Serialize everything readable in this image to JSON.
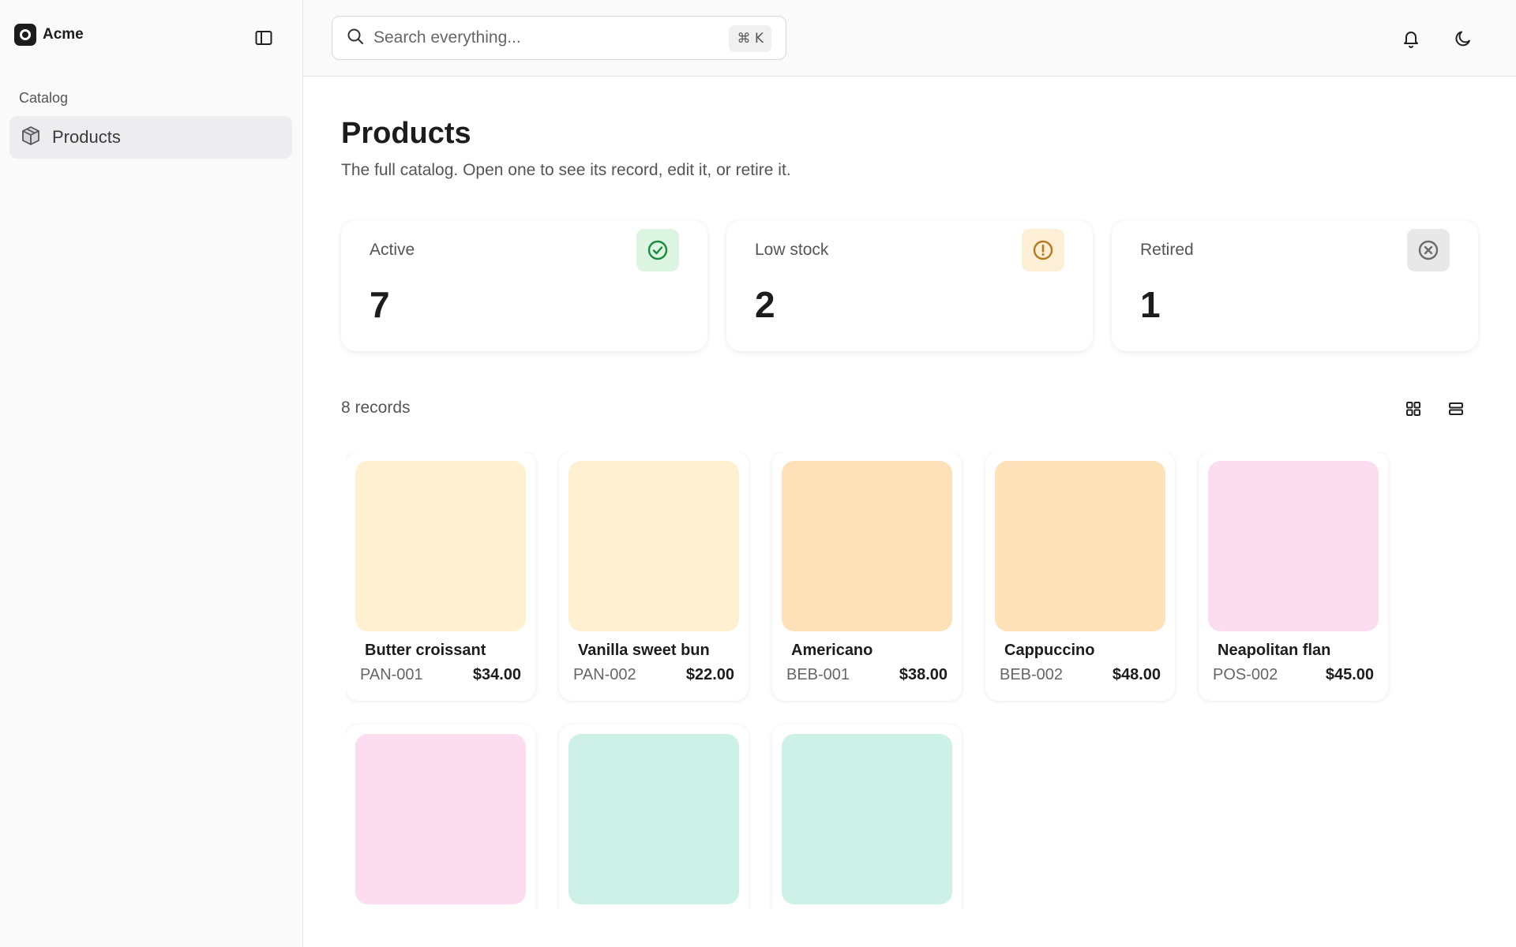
{
  "app": {
    "name": "Acme"
  },
  "sidebar": {
    "section_label": "Catalog",
    "items": [
      {
        "label": "Products",
        "icon": "package-icon",
        "active": true
      }
    ]
  },
  "topbar": {
    "search_placeholder": "Search everything...",
    "shortcut": "⌘ K",
    "icons": [
      "bell-icon",
      "moon-icon"
    ]
  },
  "page": {
    "title": "Products",
    "subtitle": "The full catalog. Open one to see its record, edit it, or retire it."
  },
  "stats": [
    {
      "label": "Active",
      "value": "7",
      "icon": "check-circle-icon",
      "icon_color": "#1e8a3e",
      "icon_bg": "#dcf5e3"
    },
    {
      "label": "Low stock",
      "value": "2",
      "icon": "alert-circle-icon",
      "icon_color": "#b7791f",
      "icon_bg": "#fdefd6"
    },
    {
      "label": "Retired",
      "value": "1",
      "icon": "x-circle-icon",
      "icon_color": "#6b6b6b",
      "icon_bg": "#e8e8e8"
    }
  ],
  "records_label": "8 records",
  "products": [
    {
      "name": "Butter croissant",
      "sku": "PAN-001",
      "price": "$34.00",
      "color": "#fef0d1"
    },
    {
      "name": "Vanilla sweet bun",
      "sku": "PAN-002",
      "price": "$22.00",
      "color": "#fef0d1"
    },
    {
      "name": "Americano",
      "sku": "BEB-001",
      "price": "$38.00",
      "color": "#fee1b8"
    },
    {
      "name": "Cappuccino",
      "sku": "BEB-002",
      "price": "$48.00",
      "color": "#fee1b8"
    },
    {
      "name": "Neapolitan flan",
      "sku": "POS-002",
      "price": "$45.00",
      "color": "#fcdcef"
    },
    {
      "name": "",
      "sku": "",
      "price": "",
      "color": "#fcdcef"
    },
    {
      "name": "",
      "sku": "",
      "price": "",
      "color": "#cdf1e7"
    },
    {
      "name": "",
      "sku": "",
      "price": "",
      "color": "#cdf1e7"
    }
  ]
}
